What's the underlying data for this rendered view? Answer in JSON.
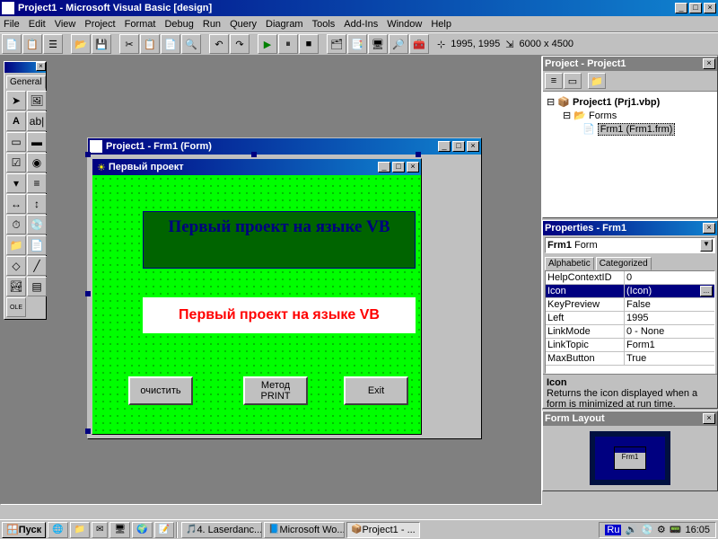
{
  "app": {
    "title": "Project1 - Microsoft Visual Basic [design]"
  },
  "menu": [
    "File",
    "Edit",
    "View",
    "Project",
    "Format",
    "Debug",
    "Run",
    "Query",
    "Diagram",
    "Tools",
    "Add-Ins",
    "Window",
    "Help"
  ],
  "toolbar_coords": "1995, 1995",
  "toolbar_size": "6000 x 4500",
  "toolbox": {
    "tab": "General"
  },
  "formwin": {
    "title": "Project1 - Frm1 (Form)"
  },
  "innerform": {
    "title": "Первый проект"
  },
  "canvas": {
    "label1": "Первый проект на языке VB",
    "label2": "Первый проект на языке VB",
    "btn_clear": "очистить",
    "btn_print": "Метод PRINT",
    "btn_exit": "Exit"
  },
  "project": {
    "title": "Project - Project1",
    "root": "Project1 (Prj1.vbp)",
    "folder": "Forms",
    "item": "Frm1 (Frm1.frm)"
  },
  "props": {
    "title": "Properties - Frm1",
    "object_name": "Frm1",
    "object_type": "Form",
    "tabs": [
      "Alphabetic",
      "Categorized"
    ],
    "rows": [
      {
        "n": "HelpContextID",
        "v": "0"
      },
      {
        "n": "Icon",
        "v": "(Icon)",
        "sel": true,
        "btn": true
      },
      {
        "n": "KeyPreview",
        "v": "False"
      },
      {
        "n": "Left",
        "v": "1995"
      },
      {
        "n": "LinkMode",
        "v": "0 - None"
      },
      {
        "n": "LinkTopic",
        "v": "Form1"
      },
      {
        "n": "MaxButton",
        "v": "True"
      }
    ],
    "desc_name": "Icon",
    "desc_text": "Returns the icon displayed when a form is minimized at run time."
  },
  "layout": {
    "title": "Form Layout",
    "formname": "Frm1"
  },
  "taskbar": {
    "start": "Пуск",
    "tasks": [
      "4. Laserdanc...",
      "Microsoft Wo...",
      "Project1 - ..."
    ],
    "lang": "Ru",
    "time": "16:05"
  }
}
